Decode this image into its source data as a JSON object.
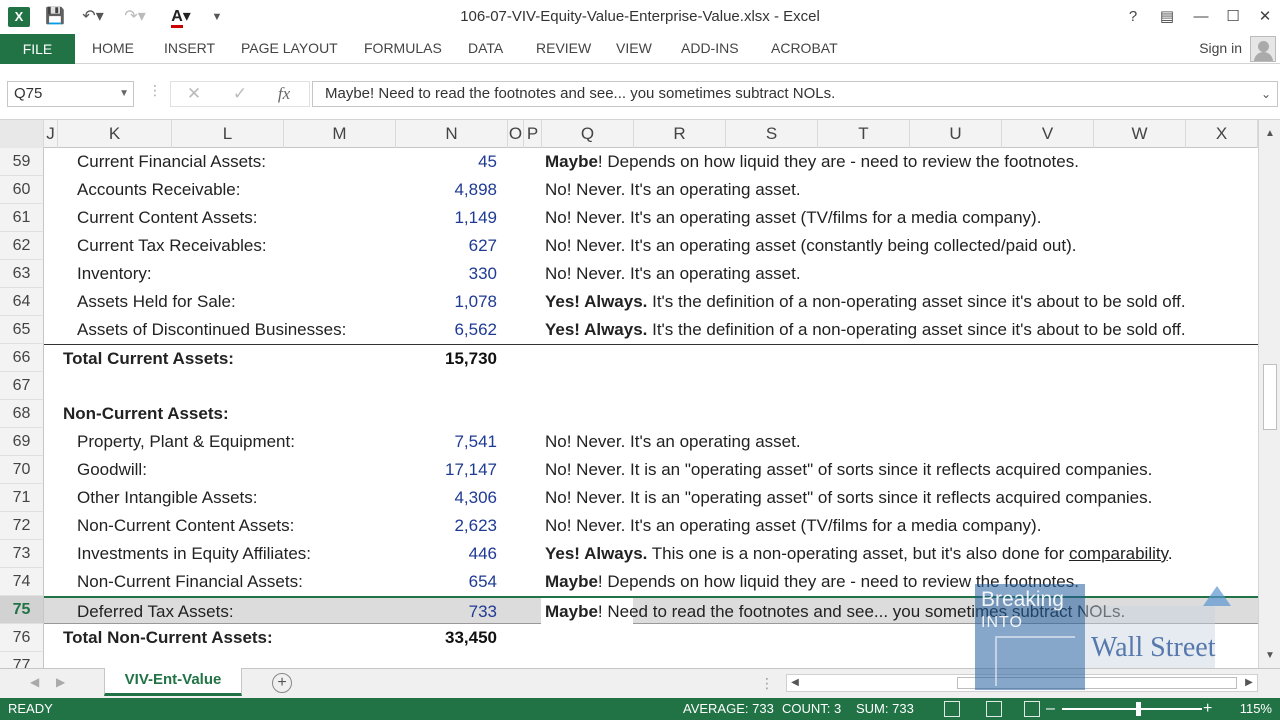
{
  "window": {
    "title": "106-07-VIV-Equity-Value-Enterprise-Value.xlsx - Excel",
    "logo": "X",
    "help": "?"
  },
  "ribbon": {
    "file": "FILE",
    "tabs": [
      "HOME",
      "INSERT",
      "PAGE LAYOUT",
      "FORMULAS",
      "DATA",
      "REVIEW",
      "VIEW",
      "ADD-INS",
      "ACROBAT"
    ],
    "sign_in": "Sign in"
  },
  "formula_bar": {
    "name_box": "Q75",
    "fx": "fx",
    "content": "Maybe! Need to read the footnotes and see... you sometimes subtract NOLs."
  },
  "columns": [
    "J",
    "K",
    "L",
    "M",
    "N",
    "O",
    "P",
    "Q",
    "R",
    "S",
    "T",
    "U",
    "V",
    "W",
    "X"
  ],
  "rows": [
    {
      "num": "59",
      "label": "Current Financial Assets:",
      "value": "45",
      "note_bold": "Maybe",
      "note": "! Depends on how liquid they are - need to review the footnotes."
    },
    {
      "num": "60",
      "label": "Accounts Receivable:",
      "value": "4,898",
      "note_bold": "",
      "note": "No! Never. It's an operating asset."
    },
    {
      "num": "61",
      "label": "Current Content Assets:",
      "value": "1,149",
      "note_bold": "",
      "note": "No! Never. It's an operating asset (TV/films for a media company)."
    },
    {
      "num": "62",
      "label": "Current Tax Receivables:",
      "value": "627",
      "note_bold": "",
      "note": "No! Never. It's an operating asset (constantly being collected/paid out)."
    },
    {
      "num": "63",
      "label": "Inventory:",
      "value": "330",
      "note_bold": "",
      "note": "No! Never. It's an operating asset."
    },
    {
      "num": "64",
      "label": "Assets Held for Sale:",
      "value": "1,078",
      "note_bold": "Yes! Always.",
      "note": " It's the definition of a non-operating asset since it's about to be sold off."
    },
    {
      "num": "65",
      "label": "Assets of Discontinued Businesses:",
      "value": "6,562",
      "note_bold": "Yes! Always.",
      "note": " It's the definition of a non-operating asset since it's about to be sold off."
    },
    {
      "num": "66",
      "label": "Total Current Assets:",
      "value": "15,730",
      "note_bold": "",
      "note": "",
      "total": true
    },
    {
      "num": "67",
      "label": "",
      "value": "",
      "note_bold": "",
      "note": ""
    },
    {
      "num": "68",
      "label": "Non-Current Assets:",
      "value": "",
      "note_bold": "",
      "note": "",
      "total": true
    },
    {
      "num": "69",
      "label": "Property, Plant & Equipment:",
      "value": "7,541",
      "note_bold": "",
      "note": "No! Never. It's an operating asset."
    },
    {
      "num": "70",
      "label": "Goodwill:",
      "value": "17,147",
      "note_bold": "",
      "note": "No! Never. It is an \"operating asset\" of sorts since it reflects acquired companies."
    },
    {
      "num": "71",
      "label": "Other Intangible Assets:",
      "value": "4,306",
      "note_bold": "",
      "note": "No! Never. It is an \"operating asset\" of sorts since it reflects acquired companies."
    },
    {
      "num": "72",
      "label": "Non-Current Content Assets:",
      "value": "2,623",
      "note_bold": "",
      "note": "No! Never. It's an operating asset (TV/films for a media company)."
    },
    {
      "num": "73",
      "label": "Investments in Equity Affiliates:",
      "value": "446",
      "note_bold": "Yes! Always.",
      "note": " This one is a non-operating asset, but it's also done for ",
      "note_under": "comparability",
      "note_tail": "."
    },
    {
      "num": "74",
      "label": "Non-Current Financial Assets:",
      "value": "654",
      "note_bold": "Maybe",
      "note": "! Depends on how liquid they are - need to review the footnotes."
    },
    {
      "num": "75",
      "label": "Deferred Tax Assets:",
      "value": "733",
      "note_bold": "Maybe",
      "note": "! Need to read the footnotes and see... you sometimes subtract NOLs.",
      "selected": true
    },
    {
      "num": "76",
      "label": "Total Non-Current Assets:",
      "value": "33,450",
      "note_bold": "",
      "note": "",
      "total": true
    },
    {
      "num": "77",
      "label": "",
      "value": "",
      "note_bold": "",
      "note": ""
    }
  ],
  "sheet": {
    "tab": "VIV-Ent-Value",
    "add": "+"
  },
  "status": {
    "ready": "READY",
    "average": "AVERAGE: 733",
    "count": "COUNT: 3",
    "sum": "SUM: 733",
    "zoom": "115%"
  },
  "watermark": {
    "line1": "Breaking",
    "line2": "INTO",
    "line3": "Wall Street"
  }
}
